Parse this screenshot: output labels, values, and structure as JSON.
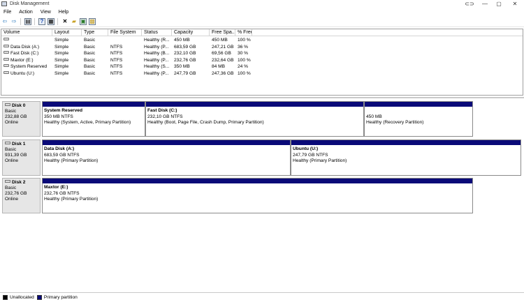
{
  "window": {
    "title": "Disk Management"
  },
  "window_controls": {
    "link": "⊂⊃",
    "minimize": "—",
    "maximize": "▢",
    "close": "✕"
  },
  "menu": [
    "File",
    "Action",
    "View",
    "Help"
  ],
  "toolbar": {
    "icons": [
      "back-arrow-icon",
      "forward-arrow-icon",
      "console-tree-icon",
      "help-icon",
      "properties-icon",
      "delete-icon",
      "open-folder-icon",
      "export-icon",
      "disk-settings-icon"
    ],
    "glyphs": [
      "⇦",
      "⇨",
      "▤",
      "?",
      "▦",
      "✕",
      "▰",
      "▣",
      "▩"
    ]
  },
  "volume_table": {
    "columns": [
      "Volume",
      "Layout",
      "Type",
      "File System",
      "Status",
      "Capacity",
      "Free Spa...",
      "% Free"
    ],
    "rows": [
      [
        "",
        "Simple",
        "Basic",
        "",
        "Healthy (R...",
        "450 MB",
        "450 MB",
        "100 %"
      ],
      [
        "Data Disk (A:)",
        "Simple",
        "Basic",
        "NTFS",
        "Healthy (P...",
        "683,59 GB",
        "247,21 GB",
        "36 %"
      ],
      [
        "Fast Disk (C:)",
        "Simple",
        "Basic",
        "NTFS",
        "Healthy (B...",
        "232,10 GB",
        "69,56 GB",
        "30 %"
      ],
      [
        "Maxtor (E:)",
        "Simple",
        "Basic",
        "NTFS",
        "Healthy (P...",
        "232,76 GB",
        "232,64 GB",
        "100 %"
      ],
      [
        "System Reserved",
        "Simple",
        "Basic",
        "NTFS",
        "Healthy (S...",
        "350 MB",
        "84 MB",
        "24 %"
      ],
      [
        "Ubuntu (U:)",
        "Simple",
        "Basic",
        "NTFS",
        "Healthy (P...",
        "247,79 GB",
        "247,36 GB",
        "100 %"
      ]
    ]
  },
  "disks": [
    {
      "name": "Disk 0",
      "type": "Basic",
      "size": "232,88 GB",
      "state": "Online",
      "partitions": [
        {
          "name": "System Reserved",
          "size": "350 MB NTFS",
          "status": "Healthy (System, Active, Primary Partition)"
        },
        {
          "name": "Fast Disk  (C:)",
          "size": "232,10 GB NTFS",
          "status": "Healthy (Boot, Page File, Crash Dump, Primary Partition)"
        },
        {
          "name": "",
          "size": "450 MB",
          "status": "Healthy (Recovery Partition)"
        }
      ]
    },
    {
      "name": "Disk 1",
      "type": "Basic",
      "size": "931,39 GB",
      "state": "Online",
      "partitions": [
        {
          "name": "Data Disk  (A:)",
          "size": "683,59 GB NTFS",
          "status": "Healthy (Primary Partition)"
        },
        {
          "name": "Ubuntu  (U:)",
          "size": "247,79 GB NTFS",
          "status": "Healthy (Primary Partition)"
        }
      ]
    },
    {
      "name": "Disk 2",
      "type": "Basic",
      "size": "232,76 GB",
      "state": "Online",
      "partitions": [
        {
          "name": "Maxtor  (E:)",
          "size": "232,76 GB NTFS",
          "status": "Healthy (Primary Partition)"
        }
      ]
    }
  ],
  "legend": [
    {
      "label": "Unallocated",
      "color": "#000000"
    },
    {
      "label": "Primary partition",
      "color": "#0a0a78"
    }
  ]
}
